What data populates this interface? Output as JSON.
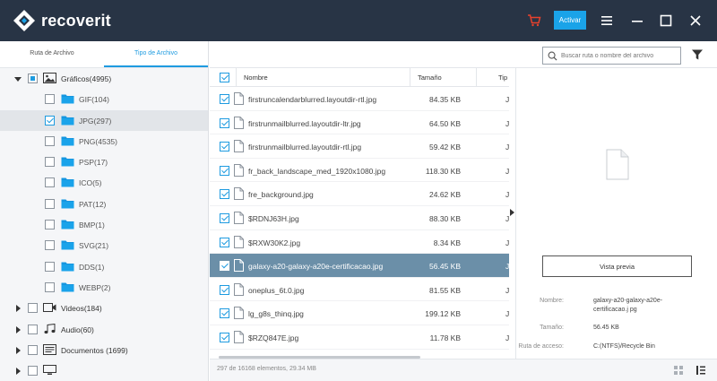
{
  "app": {
    "name": "recoverit",
    "activate_label": "Activar"
  },
  "sidebar": {
    "tabs": [
      {
        "label": "Ruta de Archivo",
        "active": false
      },
      {
        "label": "Tipo de Archivo",
        "active": true
      }
    ],
    "tree": [
      {
        "label": "Gráficos(4995)",
        "level": 0,
        "expanded": true,
        "check": "partial",
        "icon": "image-folder-icon",
        "bold": true
      },
      {
        "label": "GIF(104)",
        "level": 1,
        "check": "none",
        "icon": "folder-icon"
      },
      {
        "label": "JPG(297)",
        "level": 1,
        "check": "checked",
        "icon": "folder-icon",
        "selected": true
      },
      {
        "label": "PNG(4535)",
        "level": 1,
        "check": "none",
        "icon": "folder-icon"
      },
      {
        "label": "PSP(17)",
        "level": 1,
        "check": "none",
        "icon": "folder-icon"
      },
      {
        "label": "ICO(5)",
        "level": 1,
        "check": "none",
        "icon": "folder-icon"
      },
      {
        "label": "PAT(12)",
        "level": 1,
        "check": "none",
        "icon": "folder-icon"
      },
      {
        "label": "BMP(1)",
        "level": 1,
        "check": "none",
        "icon": "folder-icon"
      },
      {
        "label": "SVG(21)",
        "level": 1,
        "check": "none",
        "icon": "folder-icon"
      },
      {
        "label": "DDS(1)",
        "level": 1,
        "check": "none",
        "icon": "folder-icon"
      },
      {
        "label": "WEBP(2)",
        "level": 1,
        "check": "none",
        "icon": "folder-icon"
      },
      {
        "label": "Videos(184)",
        "level": 0,
        "expanded": false,
        "check": "none",
        "icon": "video-icon",
        "bold": true
      },
      {
        "label": "Audio(60)",
        "level": 0,
        "expanded": false,
        "check": "none",
        "icon": "music-icon",
        "bold": true
      },
      {
        "label": "Documentos  (1699)",
        "level": 0,
        "expanded": false,
        "check": "none",
        "icon": "document-icon",
        "bold": true
      },
      {
        "label": "",
        "level": 0,
        "expanded": false,
        "check": "none",
        "icon": "monitor-icon",
        "bold": true
      }
    ]
  },
  "search": {
    "placeholder": "Buscar ruta o nombre del archivo"
  },
  "filelist": {
    "columns": {
      "name": "Nombre",
      "size": "Tamaño",
      "type": "Tip"
    },
    "rows": [
      {
        "name": "firstruncalendarblurred.layoutdir-rtl.jpg",
        "size": "84.35  KB",
        "type": "J",
        "selected": false
      },
      {
        "name": "firstrunmailblurred.layoutdir-ltr.jpg",
        "size": "64.50  KB",
        "type": "J",
        "selected": false
      },
      {
        "name": "firstrunmailblurred.layoutdir-rtl.jpg",
        "size": "59.42  KB",
        "type": "J",
        "selected": false
      },
      {
        "name": "fr_back_landscape_med_1920x1080.jpg",
        "size": "118.30  KB",
        "type": "J",
        "selected": false
      },
      {
        "name": "fre_background.jpg",
        "size": "24.62  KB",
        "type": "J",
        "selected": false
      },
      {
        "name": "$RDNJ63H.jpg",
        "size": "88.30  KB",
        "type": "J",
        "selected": false
      },
      {
        "name": "$RXW30K2.jpg",
        "size": "8.34  KB",
        "type": "J",
        "selected": false
      },
      {
        "name": "galaxy-a20-galaxy-a20e-certificacao.jpg",
        "size": "56.45  KB",
        "type": "J",
        "selected": true
      },
      {
        "name": "oneplus_6t.0.jpg",
        "size": "81.55  KB",
        "type": "J",
        "selected": false
      },
      {
        "name": "lg_g8s_thinq.jpg",
        "size": "199.12  KB",
        "type": "J",
        "selected": false
      },
      {
        "name": "$RZQ847E.jpg",
        "size": "11.78  KB",
        "type": "J",
        "selected": false
      }
    ]
  },
  "preview": {
    "button_label": "Vista previa",
    "name_label": "Nombre:",
    "name_value": "galaxy-a20-galaxy-a20e-certificacao.j pg",
    "size_label": "Tamaño:",
    "size_value": "56.45  KB",
    "path_label": "Ruta de acceso:",
    "path_value": "C:(NTFS)/Recycle Bin"
  },
  "status": {
    "text": "297 de 16168 elementos, 29.34  MB"
  },
  "colors": {
    "titlebar": "#283445",
    "accent": "#1e9be0",
    "cart": "#e8412c",
    "selected_row": "#6b8fa8"
  }
}
